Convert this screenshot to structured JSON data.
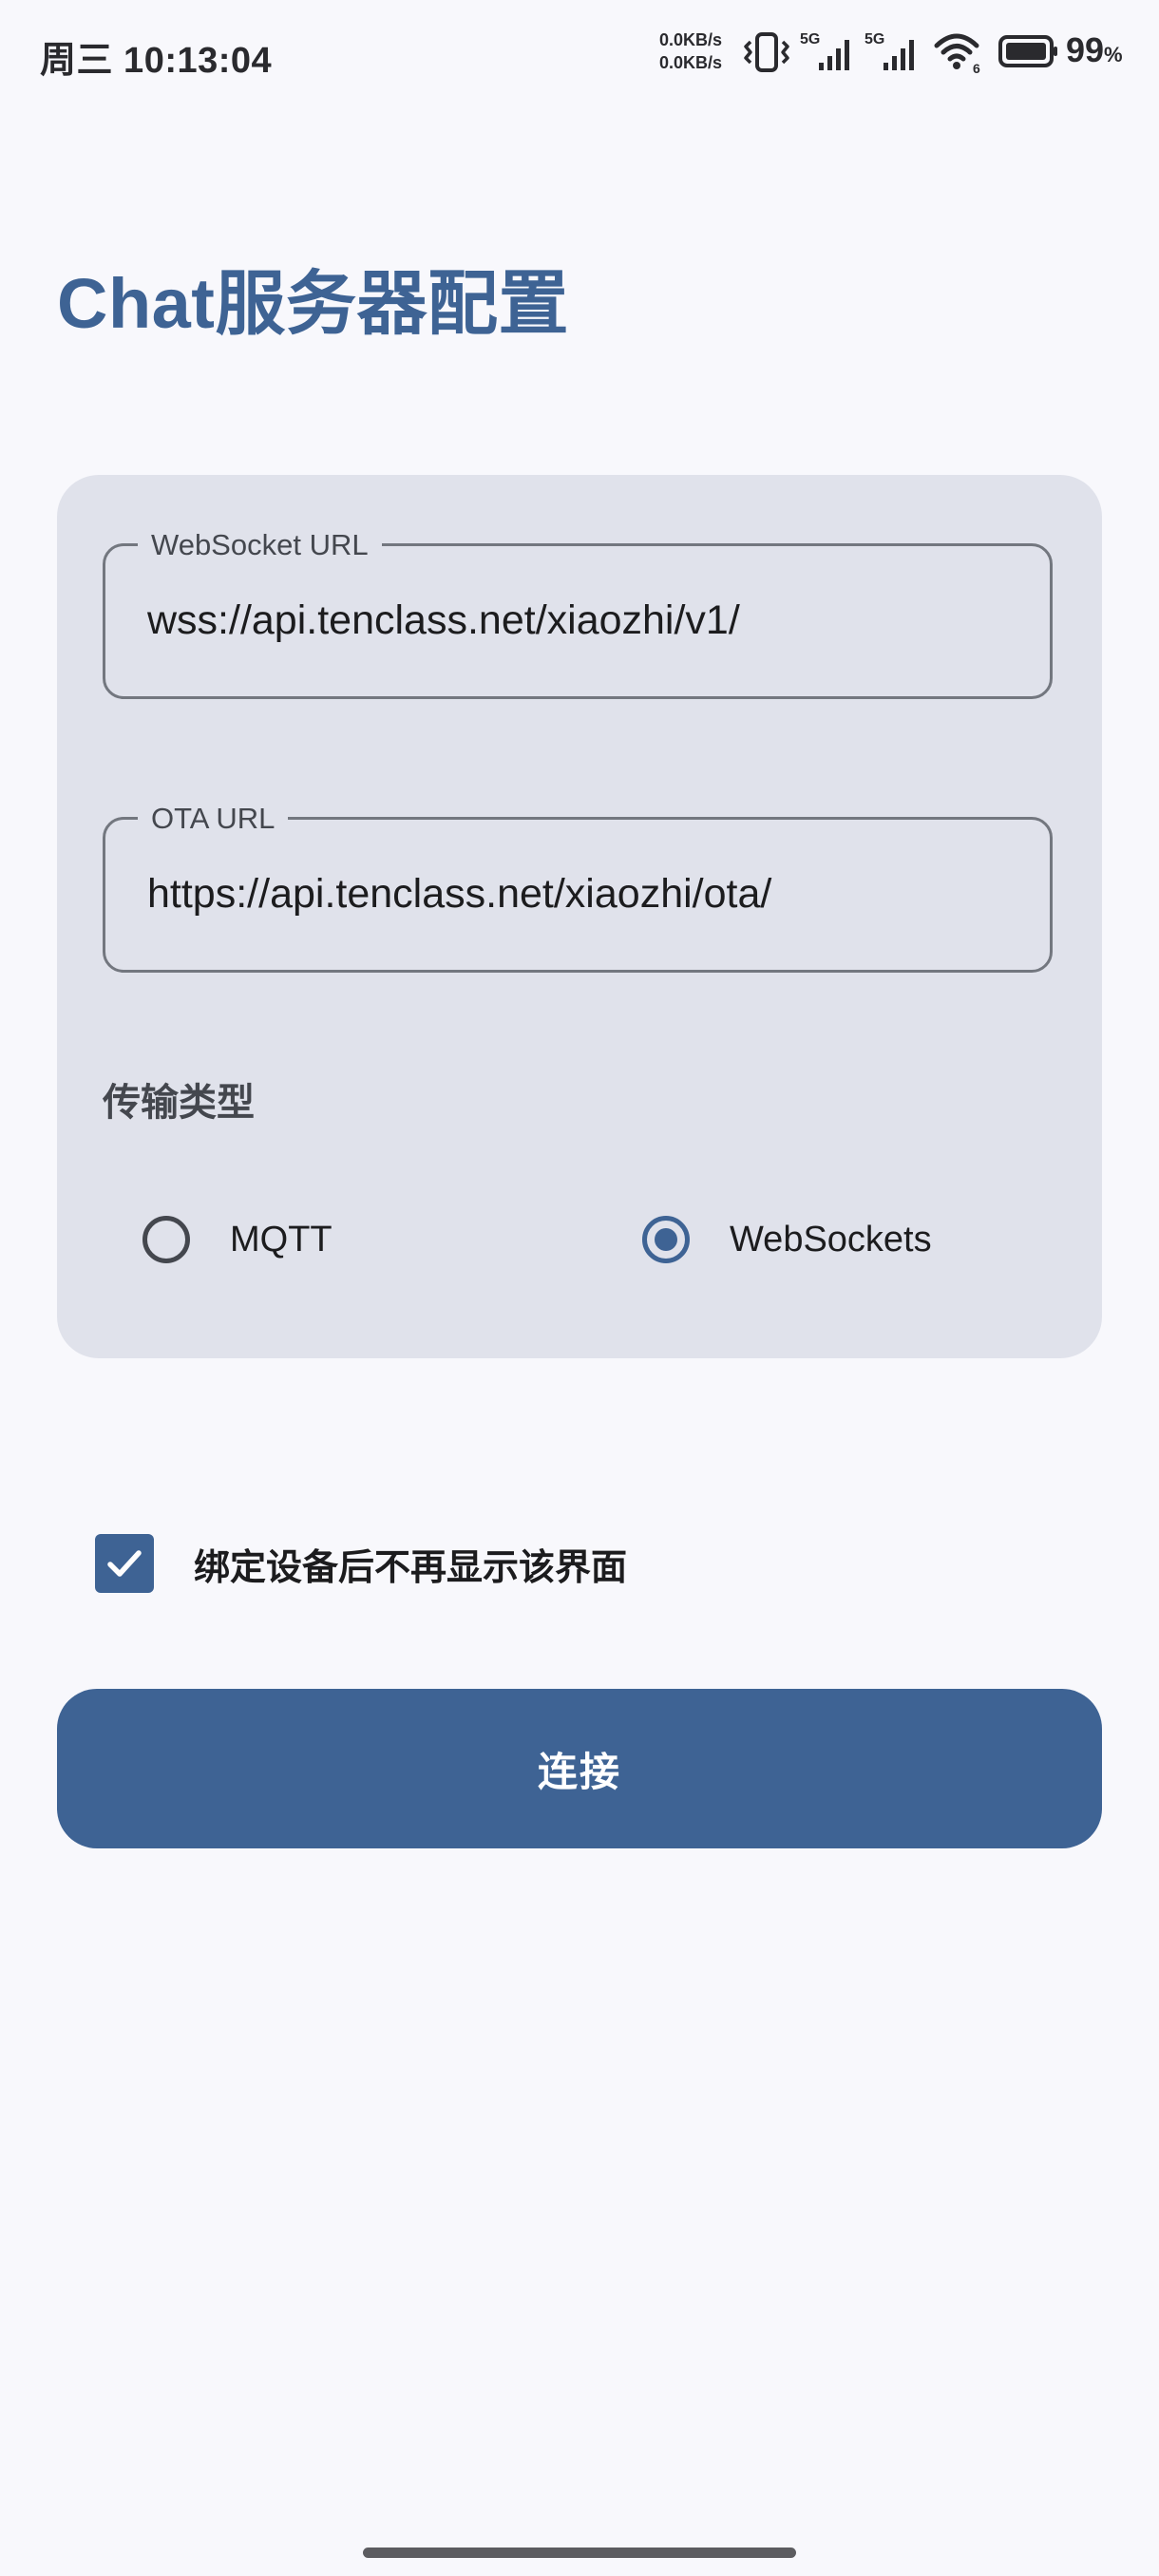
{
  "status_bar": {
    "time": "周三 10:13:04",
    "net_speed_up": "0.0KB/s",
    "net_speed_down": "0.0KB/s",
    "sim1_label": "5G",
    "sim2_label": "5G",
    "wifi_label": "6",
    "battery_percent": "99",
    "battery_unit": "%",
    "icons": [
      "vibrate-icon",
      "signal-5g-icon",
      "signal-5g-icon",
      "wifi-icon",
      "battery-icon"
    ]
  },
  "page": {
    "title": "Chat服务器配置"
  },
  "form": {
    "websocket_url": {
      "label": "WebSocket URL",
      "value": "wss://api.tenclass.net/xiaozhi/v1/"
    },
    "ota_url": {
      "label": "OTA URL",
      "value": "https://api.tenclass.net/xiaozhi/ota/"
    },
    "transport": {
      "label": "传输类型",
      "options": [
        {
          "label": "MQTT",
          "selected": false
        },
        {
          "label": "WebSockets",
          "selected": true
        }
      ]
    },
    "hide_after_bind": {
      "label": "绑定设备后不再显示该界面",
      "checked": true
    },
    "connect_label": "连接"
  },
  "colors": {
    "accent": "#3e6394",
    "card_bg": "#e0e2eb",
    "page_bg": "#f8f8fc"
  }
}
